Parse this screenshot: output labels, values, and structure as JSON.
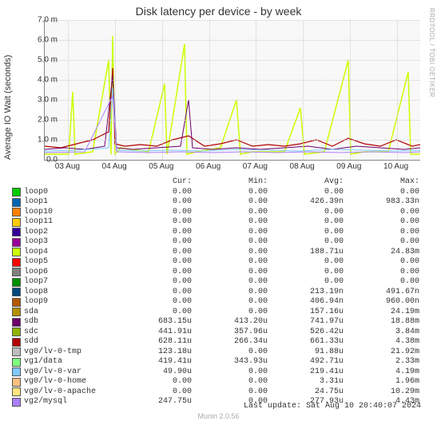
{
  "chart_data": {
    "type": "line",
    "title": "Disk latency per device - by week",
    "ylabel": "Average IO Wait (seconds)",
    "yticks": [
      "0.0",
      "1.0 m",
      "2.0 m",
      "3.0 m",
      "4.0 m",
      "5.0 m",
      "6.0 m",
      "7.0 m"
    ],
    "ylim": [
      0,
      7.0
    ],
    "xticks": [
      "03 Aug",
      "04 Aug",
      "05 Aug",
      "06 Aug",
      "07 Aug",
      "08 Aug",
      "09 Aug",
      "10 Aug"
    ],
    "headers": [
      "Cur:",
      "Min:",
      "Avg:",
      "Max:"
    ],
    "series": [
      {
        "name": "loop0",
        "color": "#00cc00",
        "cur": "0.00",
        "min": "0.00",
        "avg": "0.00",
        "max": "0.00"
      },
      {
        "name": "loop1",
        "color": "#0066b3",
        "cur": "0.00",
        "min": "0.00",
        "avg": "426.39n",
        "max": "983.33n"
      },
      {
        "name": "loop10",
        "color": "#ff8000",
        "cur": "0.00",
        "min": "0.00",
        "avg": "0.00",
        "max": "0.00"
      },
      {
        "name": "loop11",
        "color": "#ffcc00",
        "cur": "0.00",
        "min": "0.00",
        "avg": "0.00",
        "max": "0.00"
      },
      {
        "name": "loop2",
        "color": "#330099",
        "cur": "0.00",
        "min": "0.00",
        "avg": "0.00",
        "max": "0.00"
      },
      {
        "name": "loop3",
        "color": "#990099",
        "cur": "0.00",
        "min": "0.00",
        "avg": "0.00",
        "max": "0.00"
      },
      {
        "name": "loop4",
        "color": "#ccff00",
        "cur": "0.00",
        "min": "0.00",
        "avg": "188.71u",
        "max": "24.83m"
      },
      {
        "name": "loop5",
        "color": "#ff0000",
        "cur": "0.00",
        "min": "0.00",
        "avg": "0.00",
        "max": "0.00"
      },
      {
        "name": "loop6",
        "color": "#808080",
        "cur": "0.00",
        "min": "0.00",
        "avg": "0.00",
        "max": "0.00"
      },
      {
        "name": "loop7",
        "color": "#008f00",
        "cur": "0.00",
        "min": "0.00",
        "avg": "0.00",
        "max": "0.00"
      },
      {
        "name": "loop8",
        "color": "#00487d",
        "cur": "0.00",
        "min": "0.00",
        "avg": "213.19n",
        "max": "491.67n"
      },
      {
        "name": "loop9",
        "color": "#b35a00",
        "cur": "0.00",
        "min": "0.00",
        "avg": "406.94n",
        "max": "960.00n"
      },
      {
        "name": "sda",
        "color": "#b38f00",
        "cur": "0.00",
        "min": "0.00",
        "avg": "157.16u",
        "max": "24.19m"
      },
      {
        "name": "sdb",
        "color": "#6b006b",
        "cur": "683.15u",
        "min": "413.20u",
        "avg": "741.97u",
        "max": "18.88m"
      },
      {
        "name": "sdc",
        "color": "#8fb300",
        "cur": "441.91u",
        "min": "357.96u",
        "avg": "526.42u",
        "max": "3.84m"
      },
      {
        "name": "sdd",
        "color": "#b30000",
        "cur": "628.11u",
        "min": "266.34u",
        "avg": "661.33u",
        "max": "4.38m"
      },
      {
        "name": "vg0/lv-0-tmp",
        "color": "#bebebe",
        "cur": "123.18u",
        "min": "0.00",
        "avg": "91.88u",
        "max": "21.92m"
      },
      {
        "name": "vg1/data",
        "color": "#80ff80",
        "cur": "419.41u",
        "min": "343.93u",
        "avg": "492.71u",
        "max": "2.33m"
      },
      {
        "name": "vg0/lv-0-var",
        "color": "#80c9ff",
        "cur": "49.90u",
        "min": "0.00",
        "avg": "219.41u",
        "max": "4.19m"
      },
      {
        "name": "vg0/lv-0-home",
        "color": "#ffc080",
        "cur": "0.00",
        "min": "0.00",
        "avg": "3.31u",
        "max": "1.96m"
      },
      {
        "name": "vg0/lv-0-apache",
        "color": "#ffe680",
        "cur": "0.00",
        "min": "0.00",
        "avg": "24.75u",
        "max": "10.29m"
      },
      {
        "name": "vg2/mysql",
        "color": "#aa80ff",
        "cur": "247.75u",
        "min": "0.00",
        "avg": "277.93u",
        "max": "4.43m"
      }
    ]
  },
  "footer": {
    "update": "Last update: Sat Aug 10 20:40:07 2024",
    "version": "Munin 2.0.56"
  },
  "side_label": "RRDTOOL / TOBI OETIKER"
}
